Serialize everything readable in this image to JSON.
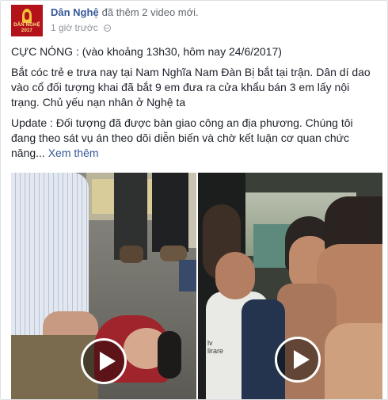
{
  "post": {
    "page_name": "Dân Nghệ",
    "action": "đã thêm 2 video mới.",
    "time": "1 giờ trước",
    "avatar_caption": "DÂN NGHỆ 2017",
    "paragraphs": [
      "CỰC NÓNG : (vào khoảng 13h30, hôm nay 24/6/2017)",
      "Bắt cóc trẻ e trưa nay tại Nam Nghĩa Nam Đàn Bị bắt tại trận. Dân dí dao vào cổ đối tượng khai đã bắt 9 em đưa ra cửa khẩu bán 3 em lấy nội trạng. Chủ yếu nạn nhân ở Nghệ ta",
      "Update : Đối tượng đã được bàn giao công an địa phương. Chúng tôi đang theo sát vụ án theo dõi diễn biến và chờ kết luận cơ quan chức năng..."
    ],
    "see_more": "Xem thêm",
    "shirt_text": "lv\nlirare"
  },
  "colors": {
    "link": "#365899",
    "text": "#1d2129",
    "meta": "#90949c"
  },
  "icons": [
    "globe-icon",
    "play-icon"
  ]
}
